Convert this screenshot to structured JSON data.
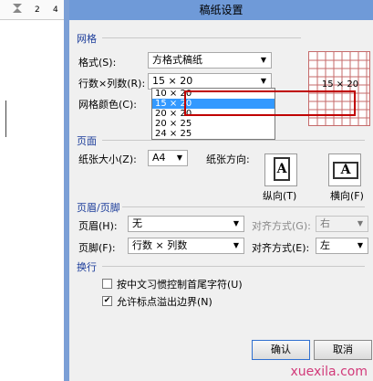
{
  "ruler": {
    "n2": "2",
    "n4": "4"
  },
  "dialog": {
    "title": "稿纸设置"
  },
  "grid_section": {
    "heading": "网格",
    "format_label": "格式(S):",
    "format_value": "方格式稿纸",
    "rows_label": "行数×列数(R):",
    "rows_value": "15 × 20",
    "color_label": "网格颜色(C):",
    "list_options": [
      "10 × 20",
      "15 × 20",
      "20 × 20",
      "20 × 25",
      "24 × 25"
    ],
    "list_selected_index": 1,
    "preview_text": "15 × 20"
  },
  "page_section": {
    "heading": "页面",
    "paper_size_label": "纸张大小(Z):",
    "paper_size_value": "A4",
    "orientation_label": "纸张方向:",
    "portrait_label": "纵向(T)",
    "landscape_label": "横向(F)",
    "page_glyph": "A"
  },
  "header_section": {
    "heading": "页眉/页脚",
    "header_label": "页眉(H):",
    "header_value": "无",
    "header_align_label": "对齐方式(G):",
    "header_align_value": "右",
    "footer_label": "页脚(F):",
    "footer_value": "行数 × 列数",
    "footer_align_label": "对齐方式(E):",
    "footer_align_value": "左"
  },
  "wrap_section": {
    "heading": "换行",
    "opt1_label": "按中文习惯控制首尾字符(U)",
    "opt1_checked": false,
    "opt2_label": "允许标点溢出边界(N)",
    "opt2_checked": true
  },
  "buttons": {
    "ok": "确认",
    "cancel": "取消"
  },
  "watermark": "xuexila.com",
  "colors": {
    "grid_red": "#c56a6a",
    "highlight_box": "#c00000",
    "selection_blue": "#3399ff",
    "titlebar": "#6f9ad8"
  }
}
